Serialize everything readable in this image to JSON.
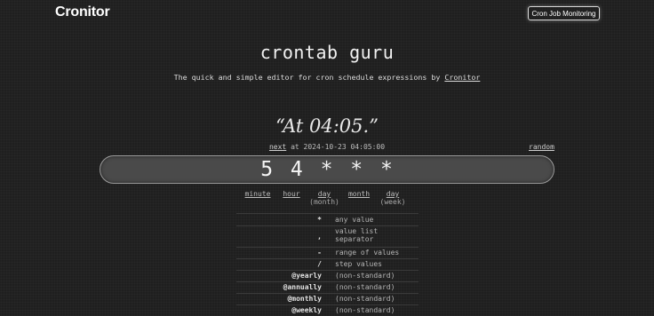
{
  "header": {
    "logo": "Cronitor",
    "nav_button": "Cron Job Monitoring"
  },
  "hero": {
    "title": "crontab guru",
    "subtitle_text": "The quick and simple editor for cron schedule expressions by",
    "subtitle_link": "Cronitor"
  },
  "result": {
    "human_readable": "“At 04:05.”",
    "next_link": "next",
    "next_text": "at 2024-10-23 04:05:00",
    "random_link": "random"
  },
  "expression": {
    "value": "5 4 * * *"
  },
  "fields": [
    {
      "label": "minute",
      "sub": ""
    },
    {
      "label": "hour",
      "sub": ""
    },
    {
      "label": "day",
      "sub": "(month)"
    },
    {
      "label": "month",
      "sub": ""
    },
    {
      "label": "day",
      "sub": "(week)"
    }
  ],
  "legend": [
    {
      "symbol": "*",
      "desc": "any value"
    },
    {
      "symbol": ",",
      "desc": "value list separator"
    },
    {
      "symbol": "-",
      "desc": "range of values"
    },
    {
      "symbol": "/",
      "desc": "step values"
    },
    {
      "symbol": "@yearly",
      "desc": "(non-standard)"
    },
    {
      "symbol": "@annually",
      "desc": "(non-standard)"
    },
    {
      "symbol": "@monthly",
      "desc": "(non-standard)"
    },
    {
      "symbol": "@weekly",
      "desc": "(non-standard)"
    }
  ]
}
